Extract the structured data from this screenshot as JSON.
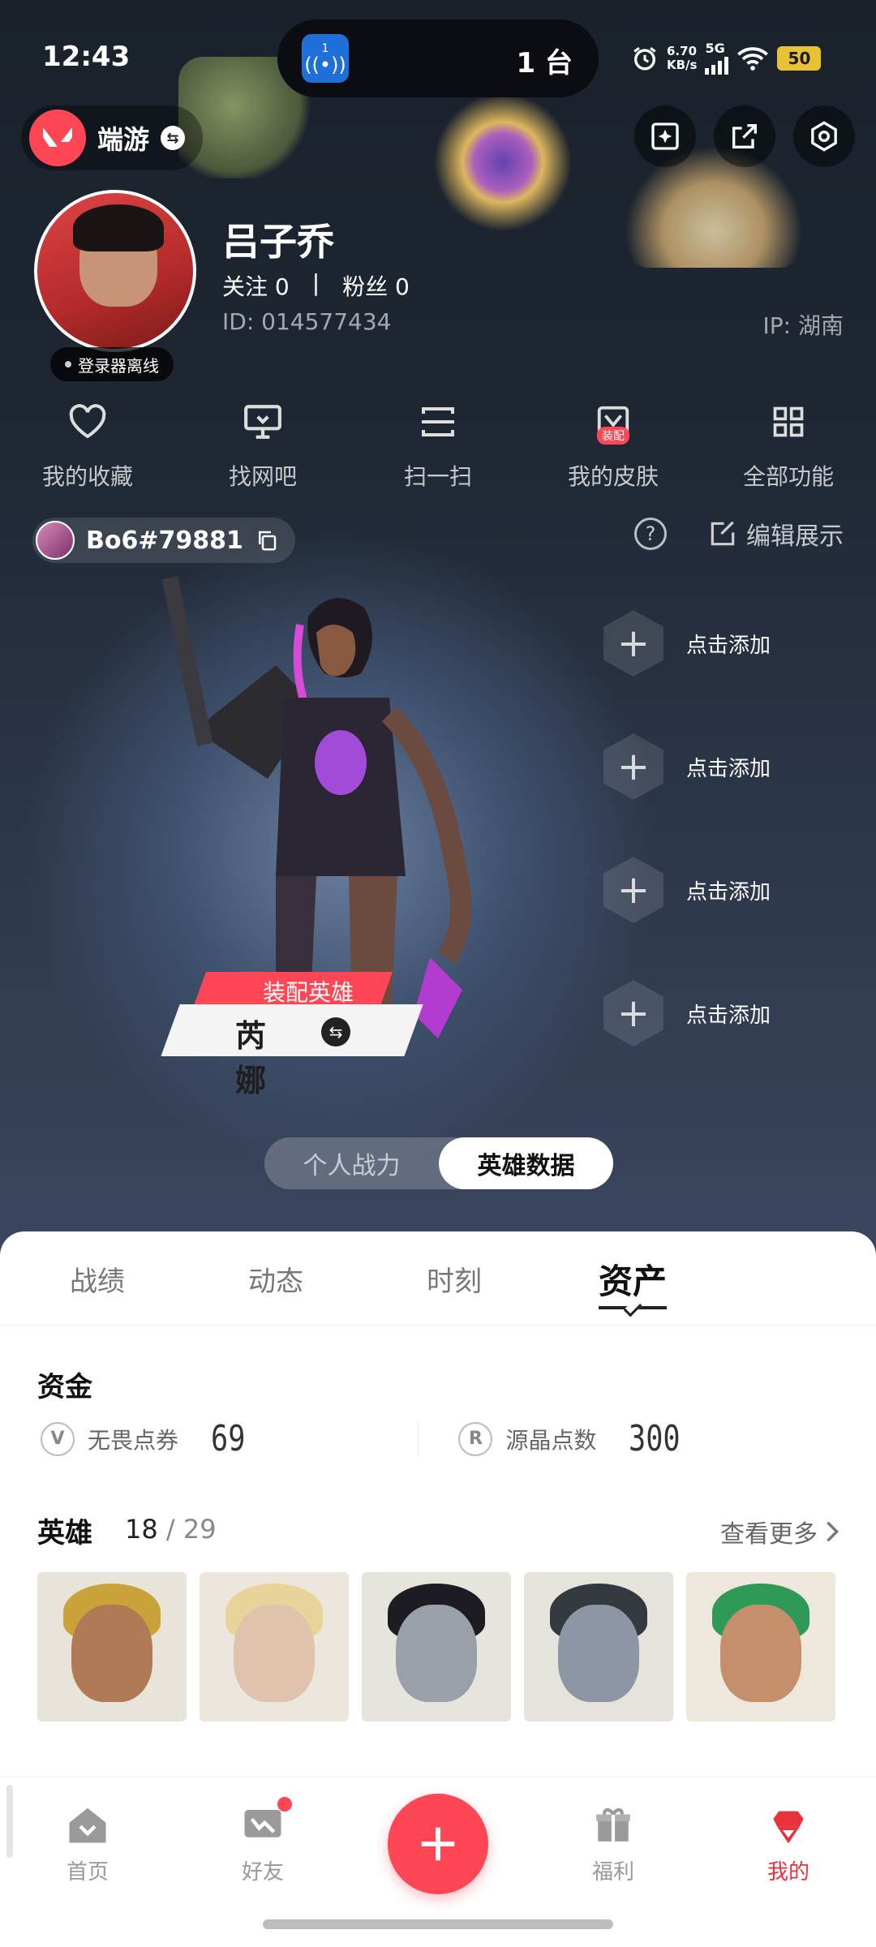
{
  "status_bar": {
    "time": "12:43",
    "pill_badge_num": "1",
    "pill_text": "1 台",
    "net_speed_value": "6.70",
    "net_speed_unit": "KB/s",
    "network": "5G",
    "battery": "50"
  },
  "header": {
    "app_name": "端游",
    "icons": [
      "sparkle-card-icon",
      "share-icon",
      "settings-hex-icon"
    ]
  },
  "profile": {
    "name": "吕子乔",
    "following": "关注 0",
    "separator": "|",
    "fans": "粉丝 0",
    "id": "ID:  014577434",
    "ip": "IP:  湖南",
    "launcher_status": "登录器离线"
  },
  "quick_actions": [
    {
      "label": "我的收藏",
      "icon": "heart-icon"
    },
    {
      "label": "找网吧",
      "icon": "monitor-icon"
    },
    {
      "label": "扫一扫",
      "icon": "scan-icon"
    },
    {
      "label": "我的皮肤",
      "icon": "skin-icon",
      "badge": "装配"
    },
    {
      "label": "全部功能",
      "icon": "grid-icon"
    }
  ],
  "riot": {
    "id": "Bo6#79881",
    "edit_label": "编辑展示",
    "help": "?"
  },
  "agent": {
    "tag": "装配英雄",
    "name": "芮娜",
    "slots": [
      {
        "label": "点击添加"
      },
      {
        "label": "点击添加"
      },
      {
        "label": "点击添加"
      },
      {
        "label": "点击添加"
      }
    ]
  },
  "toggle": {
    "options": [
      "个人战力",
      "英雄数据"
    ],
    "active": "英雄数据"
  },
  "tabs": [
    "战绩",
    "动态",
    "时刻",
    "资产"
  ],
  "active_tab": "资产",
  "funds": {
    "title": "资金",
    "items": [
      {
        "label": "无畏点券",
        "value": "69",
        "icon": "valorant-points-icon"
      },
      {
        "label": "源晶点数",
        "value": "300",
        "icon": "radianite-icon"
      }
    ]
  },
  "heroes": {
    "title": "英雄",
    "count": "18",
    "total": "29",
    "count_sep": " / ",
    "see_more": "查看更多",
    "colors": {
      "cards": [
        "#c9a33a",
        "#cdb8a0",
        "#9aa0a8",
        "#8d96a4",
        "#2f9a57"
      ]
    }
  },
  "bottom_nav": {
    "items": [
      "首页",
      "好友",
      "福利",
      "我的"
    ],
    "active": "我的"
  },
  "colors": {
    "accent": "#ff4655",
    "sheet_bg": "#ffffff",
    "hero_bg": "#1e2733"
  }
}
